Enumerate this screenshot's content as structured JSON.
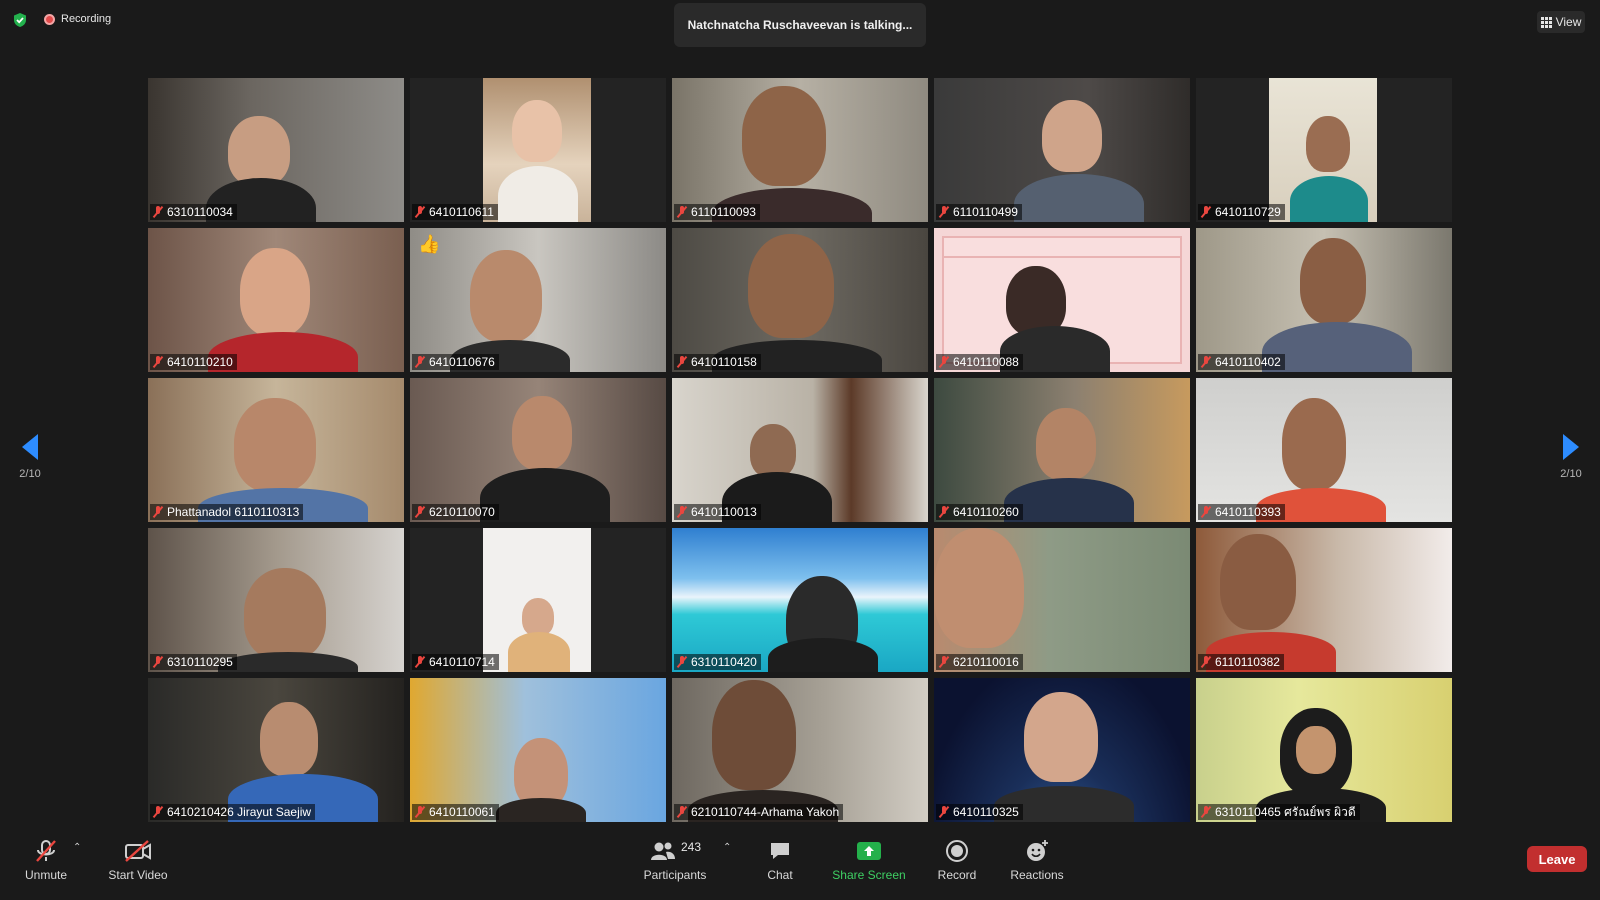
{
  "meeting": {
    "recording_label": "Recording",
    "talking_banner": "Natchnatcha Ruschaveevan is talking...",
    "view_label": "View",
    "page_indicator_left": "2/10",
    "page_indicator_right": "2/10"
  },
  "participants": [
    {
      "name": "6310110034"
    },
    {
      "name": "6410110611"
    },
    {
      "name": "6110110093"
    },
    {
      "name": "6110110499"
    },
    {
      "name": "6410110729"
    },
    {
      "name": "6410110210"
    },
    {
      "name": "6410110676"
    },
    {
      "name": "6410110158"
    },
    {
      "name": "6410110088"
    },
    {
      "name": "6410110402"
    },
    {
      "name": "Phattanadol 6110110313"
    },
    {
      "name": "6210110070"
    },
    {
      "name": "6410110013"
    },
    {
      "name": "6410110260"
    },
    {
      "name": "6410110393"
    },
    {
      "name": "6310110295"
    },
    {
      "name": "6410110714"
    },
    {
      "name": "6310110420"
    },
    {
      "name": "6210110016"
    },
    {
      "name": "6110110382"
    },
    {
      "name": "6410210426 Jirayut  Saejiw"
    },
    {
      "name": "6410110061"
    },
    {
      "name": "6210110744-Arhama Yakoh"
    },
    {
      "name": "6410110325"
    },
    {
      "name": "6310110465 ศรัณย์พร ผิวดี"
    }
  ],
  "reaction_emoji": "👍",
  "toolbar": {
    "unmute_label": "Unmute",
    "start_video_label": "Start Video",
    "participants_label": "Participants",
    "participants_count": "243",
    "chat_label": "Chat",
    "share_screen_label": "Share Screen",
    "record_label": "Record",
    "reactions_label": "Reactions",
    "leave_label": "Leave"
  },
  "colors": {
    "accent_blue": "#2d8cff",
    "leave_red": "#c22f2f",
    "share_green": "#24b04b",
    "muted_red": "#e9463f"
  }
}
